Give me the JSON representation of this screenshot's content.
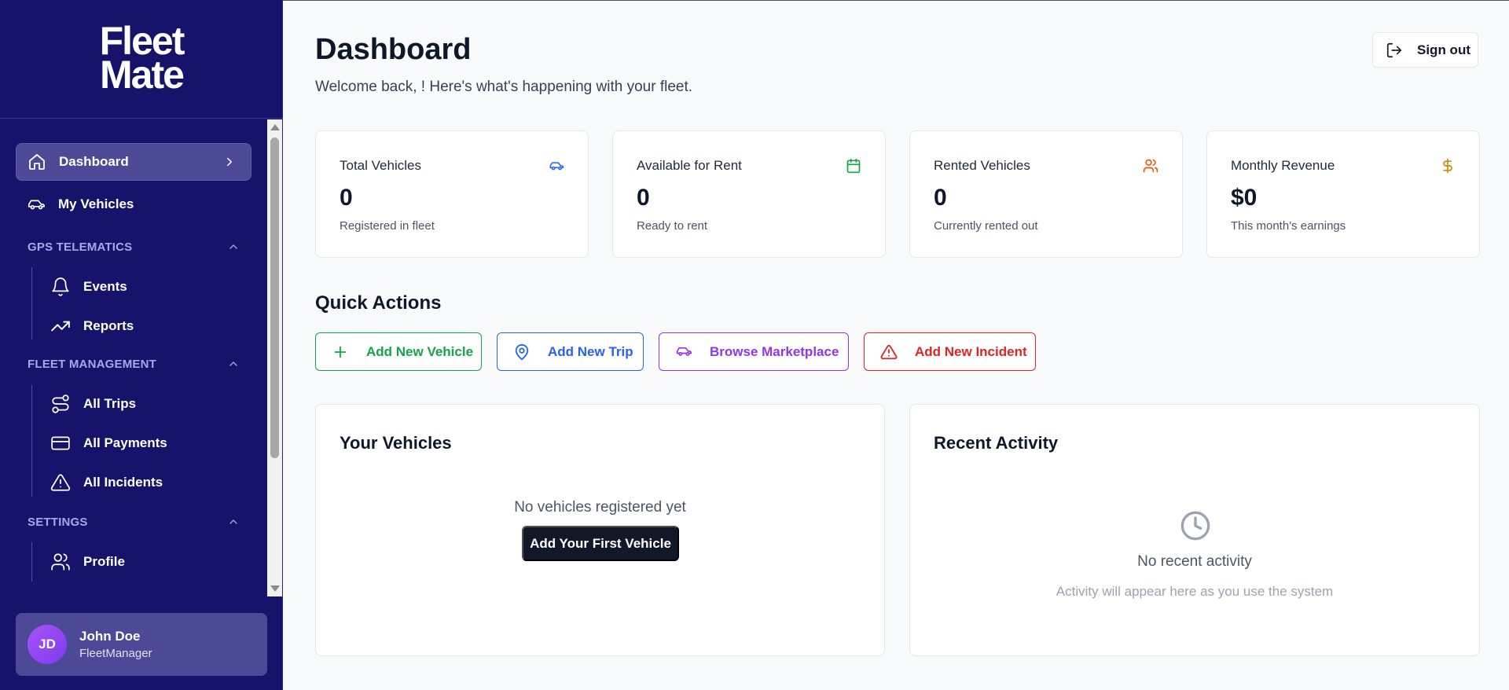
{
  "app": {
    "logo_line1": "Fleet",
    "logo_line2": "Mate"
  },
  "sidebar": {
    "dashboard": "Dashboard",
    "my_vehicles": "My Vehicles",
    "sections": {
      "gps": "GPS TELEMATICS",
      "fleet": "FLEET MANAGEMENT",
      "settings": "SETTINGS"
    },
    "gps_items": [
      "Events",
      "Reports"
    ],
    "fleet_items": [
      "All Trips",
      "All Payments",
      "All Incidents"
    ],
    "settings_items": [
      "Profile"
    ]
  },
  "user": {
    "initials": "JD",
    "name": "John Doe",
    "role": "FleetManager"
  },
  "header": {
    "title": "Dashboard",
    "welcome": "Welcome back, ! Here's what's happening with your fleet.",
    "signout": "Sign out"
  },
  "stats": [
    {
      "label": "Total Vehicles",
      "value": "0",
      "desc": "Registered in fleet",
      "icon": "car-icon",
      "color": "#2563eb"
    },
    {
      "label": "Available for Rent",
      "value": "0",
      "desc": "Ready to rent",
      "icon": "calendar-icon",
      "color": "#16a34a"
    },
    {
      "label": "Rented Vehicles",
      "value": "0",
      "desc": "Currently rented out",
      "icon": "users-icon",
      "color": "#ea580c"
    },
    {
      "label": "Monthly Revenue",
      "value": "$0",
      "desc": "This month's earnings",
      "icon": "dollar-icon",
      "color": "#ca8a04"
    }
  ],
  "quick_actions": {
    "title": "Quick Actions",
    "buttons": [
      {
        "label": "Add New Vehicle",
        "icon": "plus-icon",
        "color": "#16a34a"
      },
      {
        "label": "Add New Trip",
        "icon": "map-pin-icon",
        "color": "#2563eb"
      },
      {
        "label": "Browse Marketplace",
        "icon": "car-icon",
        "color": "#9333ea"
      },
      {
        "label": "Add New Incident",
        "icon": "alert-triangle-icon",
        "color": "#dc2626"
      }
    ]
  },
  "vehicles_panel": {
    "title": "Your Vehicles",
    "empty": "No vehicles registered yet",
    "button": "Add Your First Vehicle"
  },
  "activity_panel": {
    "title": "Recent Activity",
    "empty": "No recent activity",
    "sub": "Activity will appear here as you use the system"
  },
  "colors": {
    "sidebar_bg": "#16136b",
    "active_bg": "#4c4a96",
    "section_text": "#a5a8e6"
  }
}
